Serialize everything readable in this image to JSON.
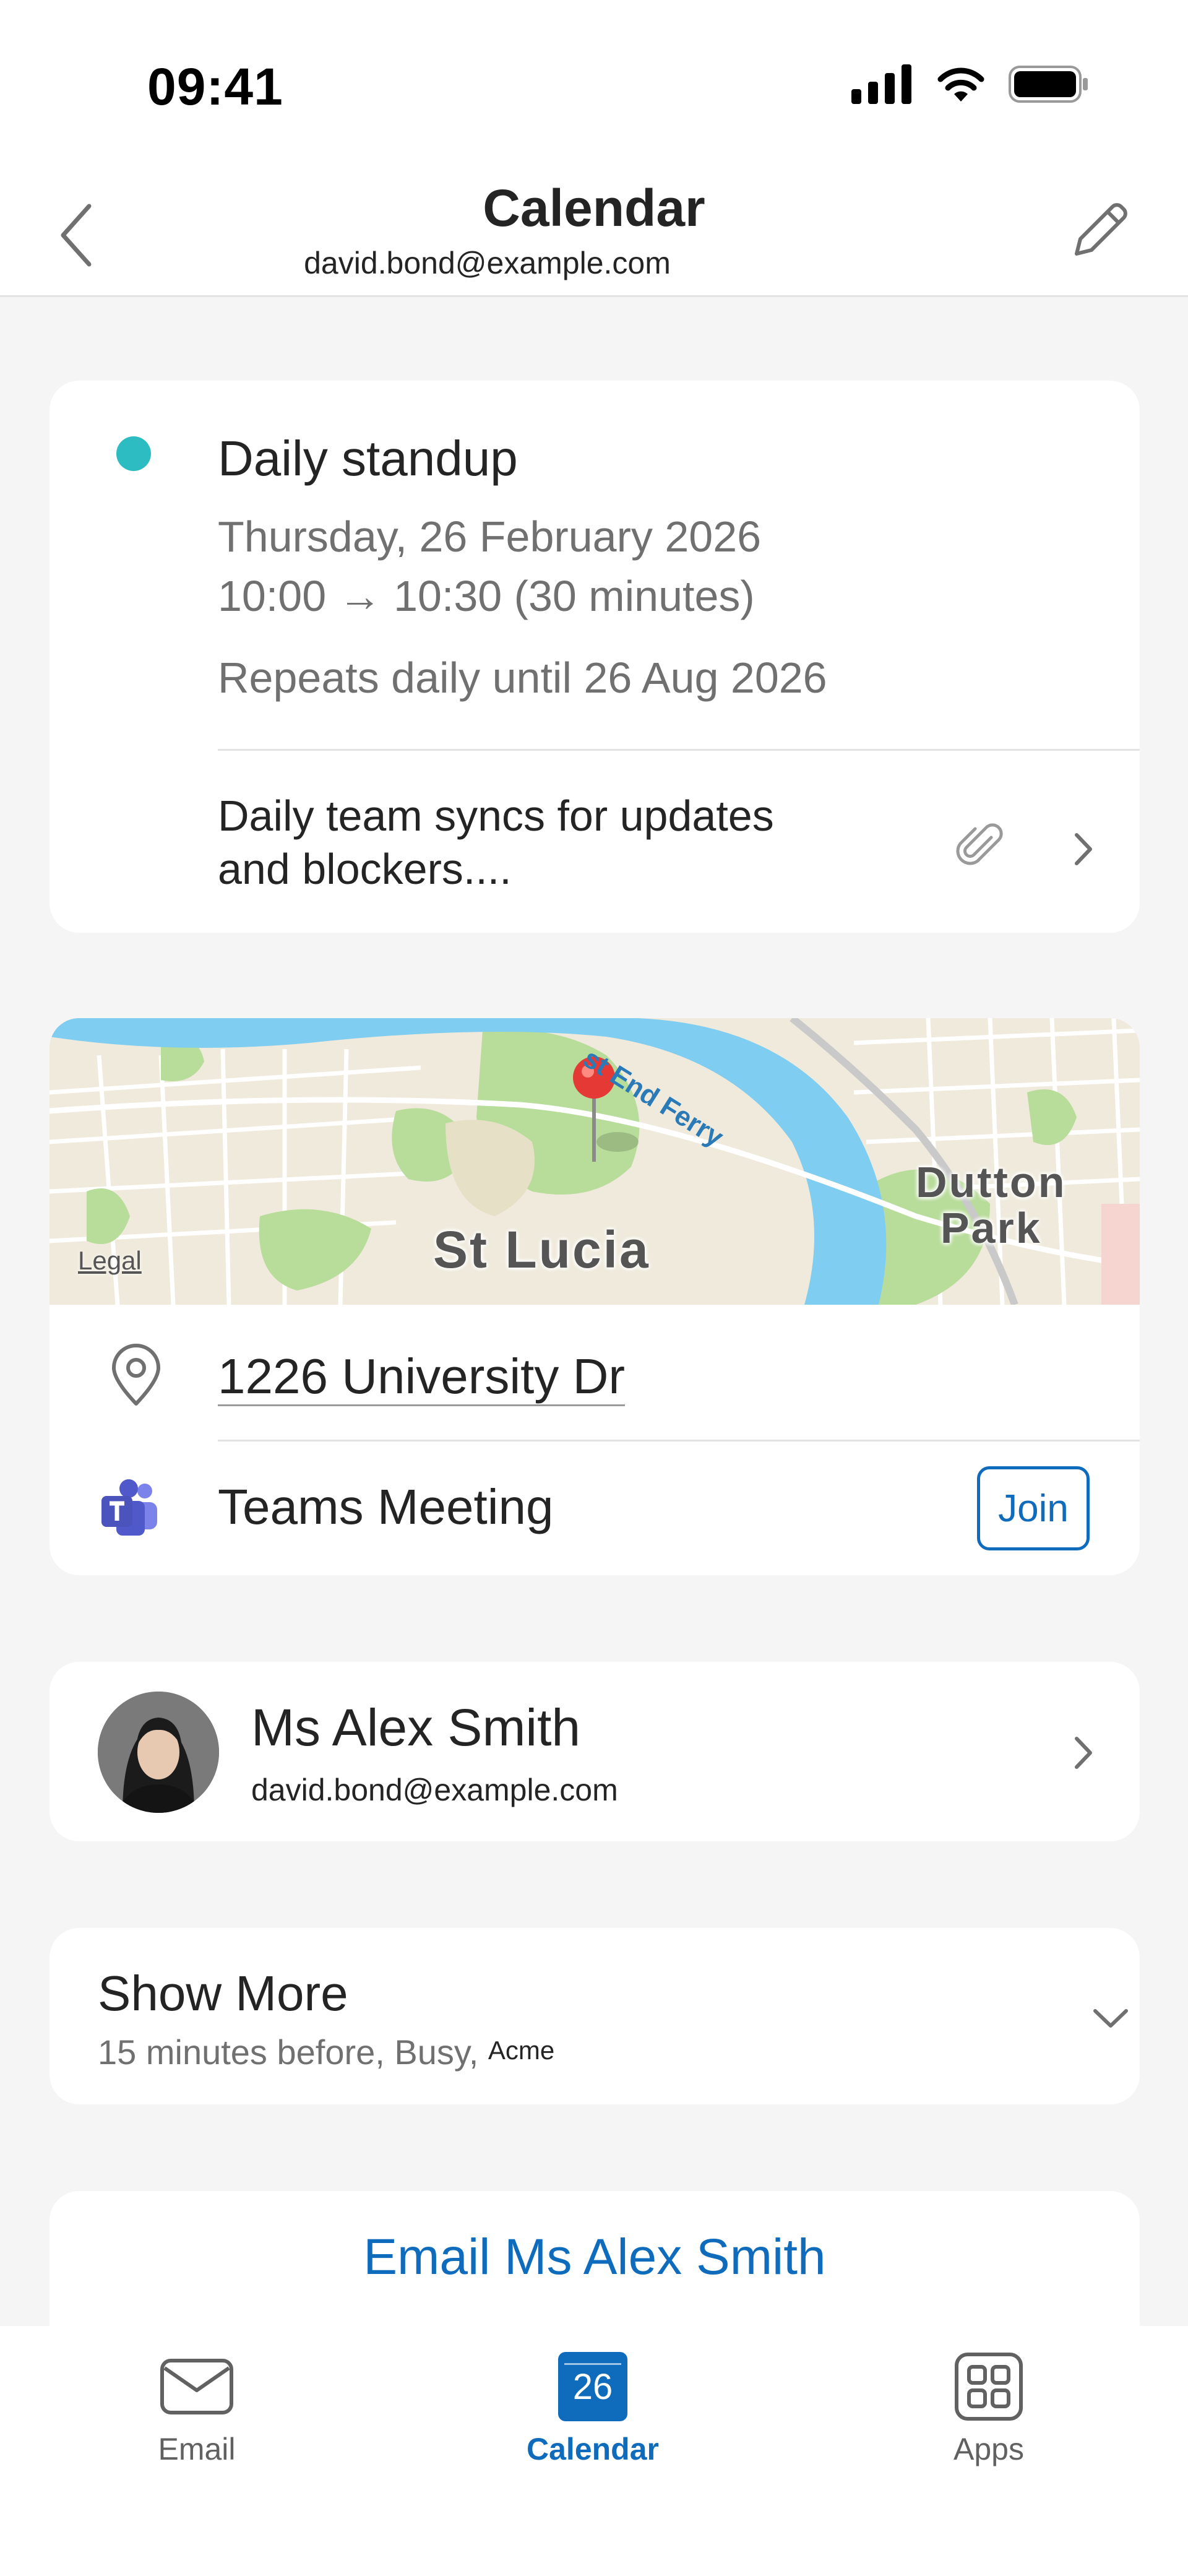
{
  "status_bar": {
    "time": "09:41"
  },
  "header": {
    "title": "Calendar",
    "subtitle": "david.bond@example.com"
  },
  "event": {
    "title": "Daily standup",
    "date": "Thursday, 26 February 2026",
    "time": "10:00 → 10:30 (30 minutes)",
    "repeat": "Repeats daily until 26 Aug 2026",
    "description_line1": "Daily team syncs for updates",
    "description_line2": "and blockers....",
    "color": "#2dbcc2"
  },
  "map": {
    "label_area": "St Lucia",
    "label_park_line1": "Dutton",
    "label_park_line2": "Park",
    "label_ferry": "st End Ferry",
    "legal": "Legal"
  },
  "location": {
    "address": "1226 University Dr",
    "meeting": "Teams Meeting",
    "join_label": "Join"
  },
  "organizer": {
    "name": "Ms Alex Smith",
    "email": "david.bond@example.com"
  },
  "show_more": {
    "title": "Show More",
    "summary": "15 minutes before, Busy,",
    "summary_small": "Acme"
  },
  "actions": {
    "email_label": "Email Ms Alex Smith"
  },
  "tabs": [
    {
      "label": "Email",
      "icon": "mail-icon"
    },
    {
      "label": "Calendar",
      "icon": "calendar-icon",
      "badge": "26",
      "active": true
    },
    {
      "label": "Apps",
      "icon": "apps-icon"
    }
  ],
  "colors": {
    "accent": "#0f6cbd",
    "background": "#f5f5f5",
    "secondary_text": "#707070"
  }
}
